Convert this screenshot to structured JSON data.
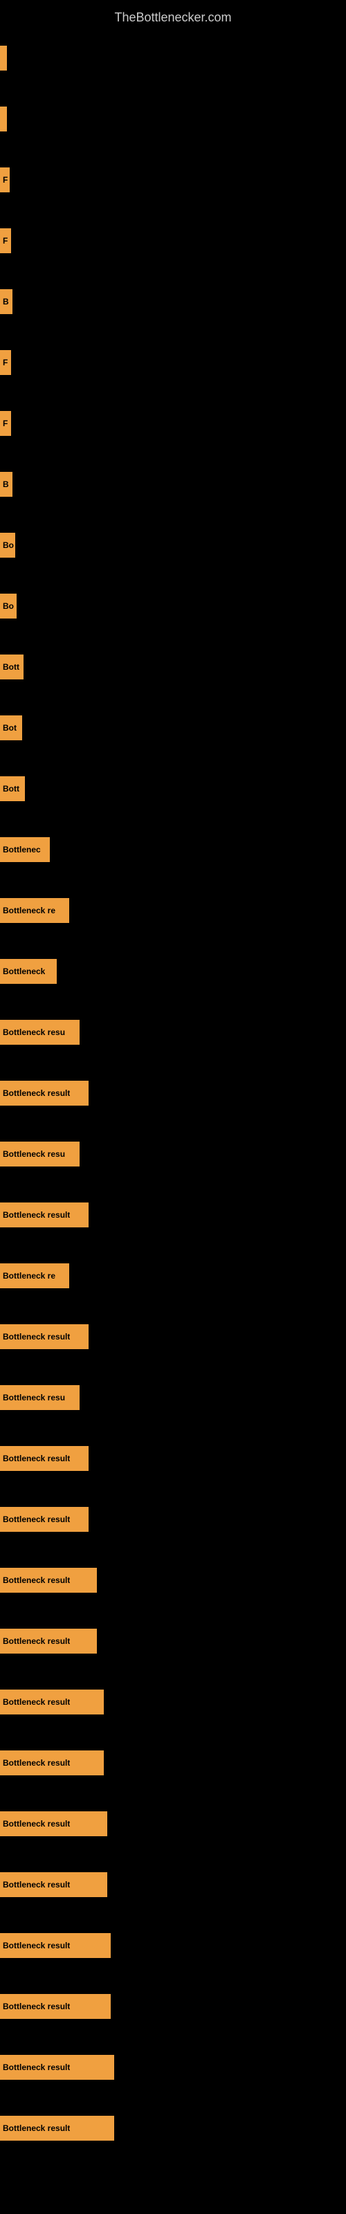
{
  "site": {
    "title": "TheBottlenecker.com"
  },
  "bars": [
    {
      "label": "",
      "width": 8
    },
    {
      "label": "",
      "width": 10
    },
    {
      "label": "F",
      "width": 14
    },
    {
      "label": "F",
      "width": 16
    },
    {
      "label": "B",
      "width": 18
    },
    {
      "label": "F",
      "width": 16
    },
    {
      "label": "F",
      "width": 16
    },
    {
      "label": "B",
      "width": 18
    },
    {
      "label": "Bo",
      "width": 22
    },
    {
      "label": "Bo",
      "width": 24
    },
    {
      "label": "Bott",
      "width": 34
    },
    {
      "label": "Bot",
      "width": 32
    },
    {
      "label": "Bott",
      "width": 36
    },
    {
      "label": "Bottlenec",
      "width": 72
    },
    {
      "label": "Bottleneck re",
      "width": 100
    },
    {
      "label": "Bottleneck",
      "width": 82
    },
    {
      "label": "Bottleneck resu",
      "width": 115
    },
    {
      "label": "Bottleneck result",
      "width": 128
    },
    {
      "label": "Bottleneck resu",
      "width": 115
    },
    {
      "label": "Bottleneck result",
      "width": 128
    },
    {
      "label": "Bottleneck re",
      "width": 100
    },
    {
      "label": "Bottleneck result",
      "width": 128
    },
    {
      "label": "Bottleneck resu",
      "width": 115
    },
    {
      "label": "Bottleneck result",
      "width": 128
    },
    {
      "label": "Bottleneck result",
      "width": 128
    },
    {
      "label": "Bottleneck result",
      "width": 140
    },
    {
      "label": "Bottleneck result",
      "width": 140
    },
    {
      "label": "Bottleneck result",
      "width": 150
    },
    {
      "label": "Bottleneck result",
      "width": 150
    },
    {
      "label": "Bottleneck result",
      "width": 155
    },
    {
      "label": "Bottleneck result",
      "width": 155
    },
    {
      "label": "Bottleneck result",
      "width": 160
    },
    {
      "label": "Bottleneck result",
      "width": 160
    },
    {
      "label": "Bottleneck result",
      "width": 165
    },
    {
      "label": "Bottleneck result",
      "width": 165
    }
  ]
}
